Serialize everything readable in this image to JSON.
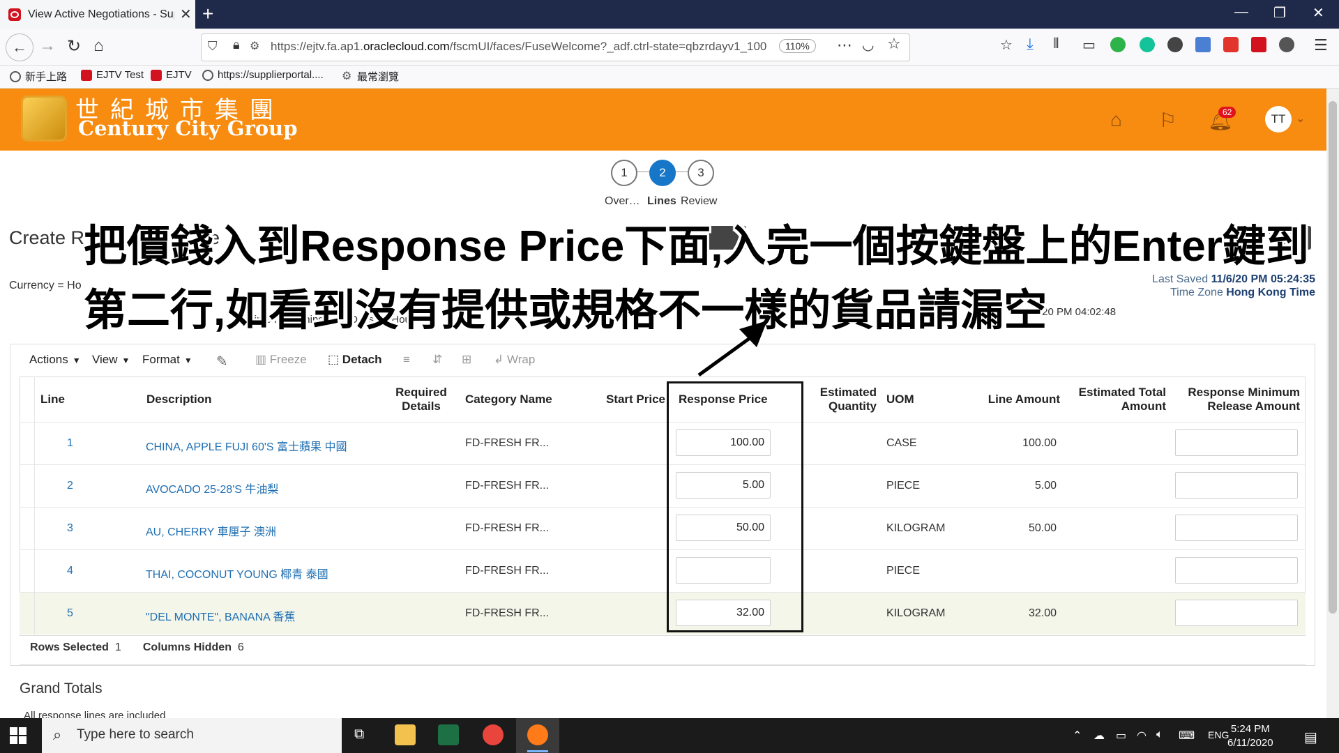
{
  "browser": {
    "tab_title": "View Active Negotiations - Sup",
    "url_prefix": "https://ejtv.fa.ap1.",
    "url_domain": "oraclecloud.com",
    "url_suffix": "/fscmUI/faces/FuseWelcome?_adf.ctrl-state=qbzrdayv1_100",
    "zoom": "110%",
    "bookmarks": [
      "新手上路",
      "EJTV Test",
      "EJTV",
      "https://supplierportal....",
      "最常瀏覽"
    ]
  },
  "header": {
    "logo_cn": "世紀城市集團",
    "logo_en": "Century City Group",
    "notification_count": "62",
    "avatar_initials": "TT"
  },
  "train": {
    "steps": [
      {
        "num": "1",
        "label": "Over…"
      },
      {
        "num": "2",
        "label": "Lines"
      },
      {
        "num": "3",
        "label": "Review"
      }
    ]
  },
  "page": {
    "title_partial": "Create R",
    "title_partial2": "e",
    "currency_partial": "Currency = Ho",
    "time_remaining_label": "Time Remaining",
    "time_remaining_value": "12 Days 22 Hours",
    "close_time_partial": "/20 PM 04:02:48",
    "last_saved_label": "Last Saved",
    "last_saved_value": "11/6/20 PM 05:24:35",
    "timezone_label": "Time Zone",
    "timezone_value": "Hong Kong Time"
  },
  "toolbar": {
    "actions": "Actions",
    "view": "View",
    "format": "Format",
    "freeze": "Freeze",
    "detach": "Detach",
    "wrap": "Wrap"
  },
  "table": {
    "headers": {
      "line": "Line",
      "description": "Description",
      "required_1": "Required",
      "required_2": "Details",
      "category": "Category Name",
      "start_price": "Start Price",
      "response_price": "Response Price",
      "est_qty_1": "Estimated",
      "est_qty_2": "Quantity",
      "uom": "UOM",
      "line_amount": "Line Amount",
      "est_total_1": "Estimated Total",
      "est_total_2": "Amount",
      "resp_min_1": "Response Minimum",
      "resp_min_2": "Release Amount"
    },
    "rows": [
      {
        "line": "1",
        "description": "CHINA, APPLE FUJI 60'S 富士蘋果 中國",
        "category": "FD-FRESH FR...",
        "response_price": "100.00",
        "uom": "CASE",
        "line_amount": "100.00"
      },
      {
        "line": "2",
        "description": "AVOCADO 25-28'S 牛油梨",
        "category": "FD-FRESH FR...",
        "response_price": "5.00",
        "uom": "PIECE",
        "line_amount": "5.00"
      },
      {
        "line": "3",
        "description": "AU, CHERRY 車厘子 澳洲",
        "category": "FD-FRESH FR...",
        "response_price": "50.00",
        "uom": "KILOGRAM",
        "line_amount": "50.00"
      },
      {
        "line": "4",
        "description": "THAI, COCONUT YOUNG 椰青 泰國",
        "category": "FD-FRESH FR...",
        "response_price": "",
        "uom": "PIECE",
        "line_amount": ""
      },
      {
        "line": "5",
        "description": "\"DEL MONTE\", BANANA 香蕉",
        "category": "FD-FRESH FR...",
        "response_price": "32.00",
        "uom": "KILOGRAM",
        "line_amount": "32.00"
      }
    ],
    "rows_selected_label": "Rows Selected",
    "rows_selected_value": "1",
    "columns_hidden_label": "Columns Hidden",
    "columns_hidden_value": "6"
  },
  "totals": {
    "title": "Grand Totals",
    "note": "All response lines are included"
  },
  "annotation": {
    "line1": "把價錢入到Response Price下面,入完一個按鍵盤上的Enter鍵到",
    "line2": "第二行,如看到沒有提供或規格不一樣的貨品請漏空"
  },
  "taskbar": {
    "search_placeholder": "Type here to search",
    "lang": "ENG",
    "time": "5:24 PM",
    "date": "6/11/2020"
  }
}
